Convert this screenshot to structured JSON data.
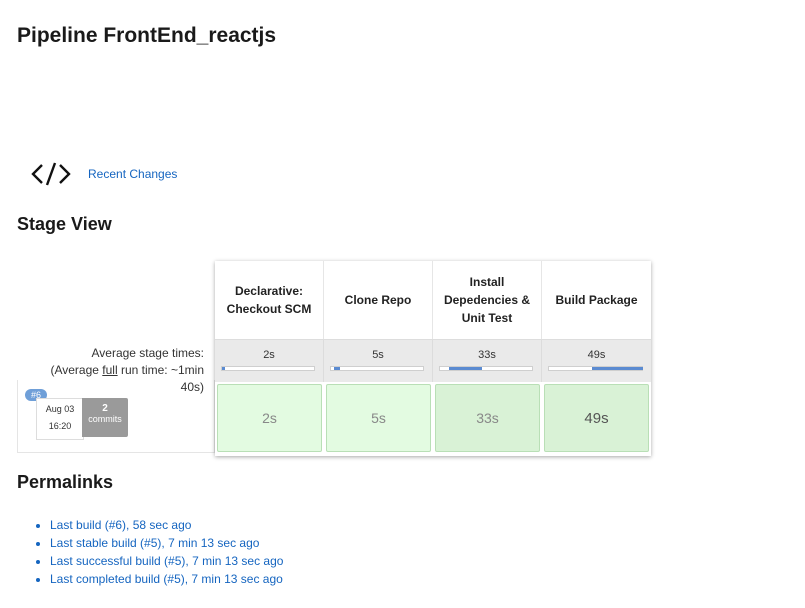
{
  "page": {
    "title": "Pipeline FrontEnd_reactjs"
  },
  "recent": {
    "icon": "code-icon",
    "label": "Recent Changes"
  },
  "stage_view": {
    "title": "Stage View",
    "avg_label_line1": "Average stage times:",
    "avg_label_line2a": "(Average ",
    "avg_label_full": "full",
    "avg_label_line2b": " run time: ~1min",
    "avg_label_line3": "40s)",
    "stages": [
      {
        "name": "Declarative: Checkout SCM",
        "avg": "2s",
        "avg_fraction": 0.03,
        "cell": "2s"
      },
      {
        "name": "Clone Repo",
        "avg": "5s",
        "avg_fraction": 0.07,
        "cell": "5s"
      },
      {
        "name": "Install Depedencies & Unit Test",
        "avg": "33s",
        "avg_fraction": 0.36,
        "cell": "33s"
      },
      {
        "name": "Build Package",
        "avg": "49s",
        "avg_fraction": 0.55,
        "cell": "49s"
      }
    ],
    "build": {
      "number": "#6",
      "date": "Aug 03",
      "time": "16:20",
      "commits_count": "2",
      "commits_label": "commits"
    }
  },
  "permalinks": {
    "title": "Permalinks",
    "items": [
      "Last build (#6), 58 sec ago",
      "Last stable build (#5), 7 min 13 sec ago",
      "Last successful build (#5), 7 min 13 sec ago",
      "Last completed build (#5), 7 min 13 sec ago"
    ]
  },
  "colors": {
    "link": "#1565c0",
    "success_cell": "#e3fbe1",
    "bar_fill": "#5b8bd1",
    "badge": "#6f9fd8"
  }
}
